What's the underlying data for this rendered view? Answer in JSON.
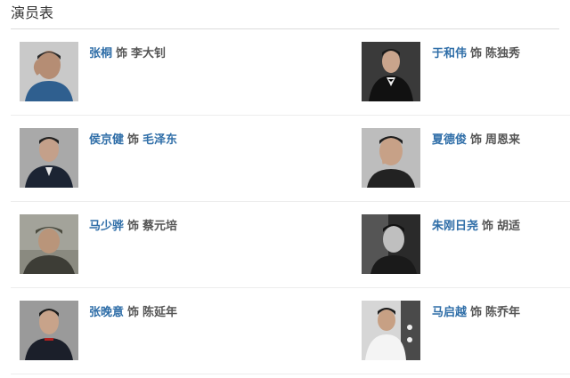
{
  "header": {
    "title": "演员表"
  },
  "cast_rows": [
    {
      "left": {
        "actor": "张桐",
        "prefix": "饰",
        "role": "李大钊",
        "role_is_link": false
      },
      "right": {
        "actor": "于和伟",
        "prefix": "饰",
        "role": "陈独秀",
        "role_is_link": false
      }
    },
    {
      "left": {
        "actor": "侯京健",
        "prefix": "饰",
        "role": "毛泽东",
        "role_is_link": true
      },
      "right": {
        "actor": "夏德俊",
        "prefix": "饰",
        "role": "周恩来",
        "role_is_link": false
      }
    },
    {
      "left": {
        "actor": "马少骅",
        "prefix": "饰",
        "role": "蔡元培",
        "role_is_link": false
      },
      "right": {
        "actor": "朱刚日尧",
        "prefix": "饰",
        "role": "胡适",
        "role_is_link": false
      }
    },
    {
      "left": {
        "actor": "张晚意",
        "prefix": "饰",
        "role": "陈延年",
        "role_is_link": false
      },
      "right": {
        "actor": "马启越",
        "prefix": "饰",
        "role": "陈乔年",
        "role_is_link": false
      }
    }
  ],
  "colors": {
    "link": "#2f6ea8",
    "text": "#555555",
    "divider": "#ececec"
  }
}
